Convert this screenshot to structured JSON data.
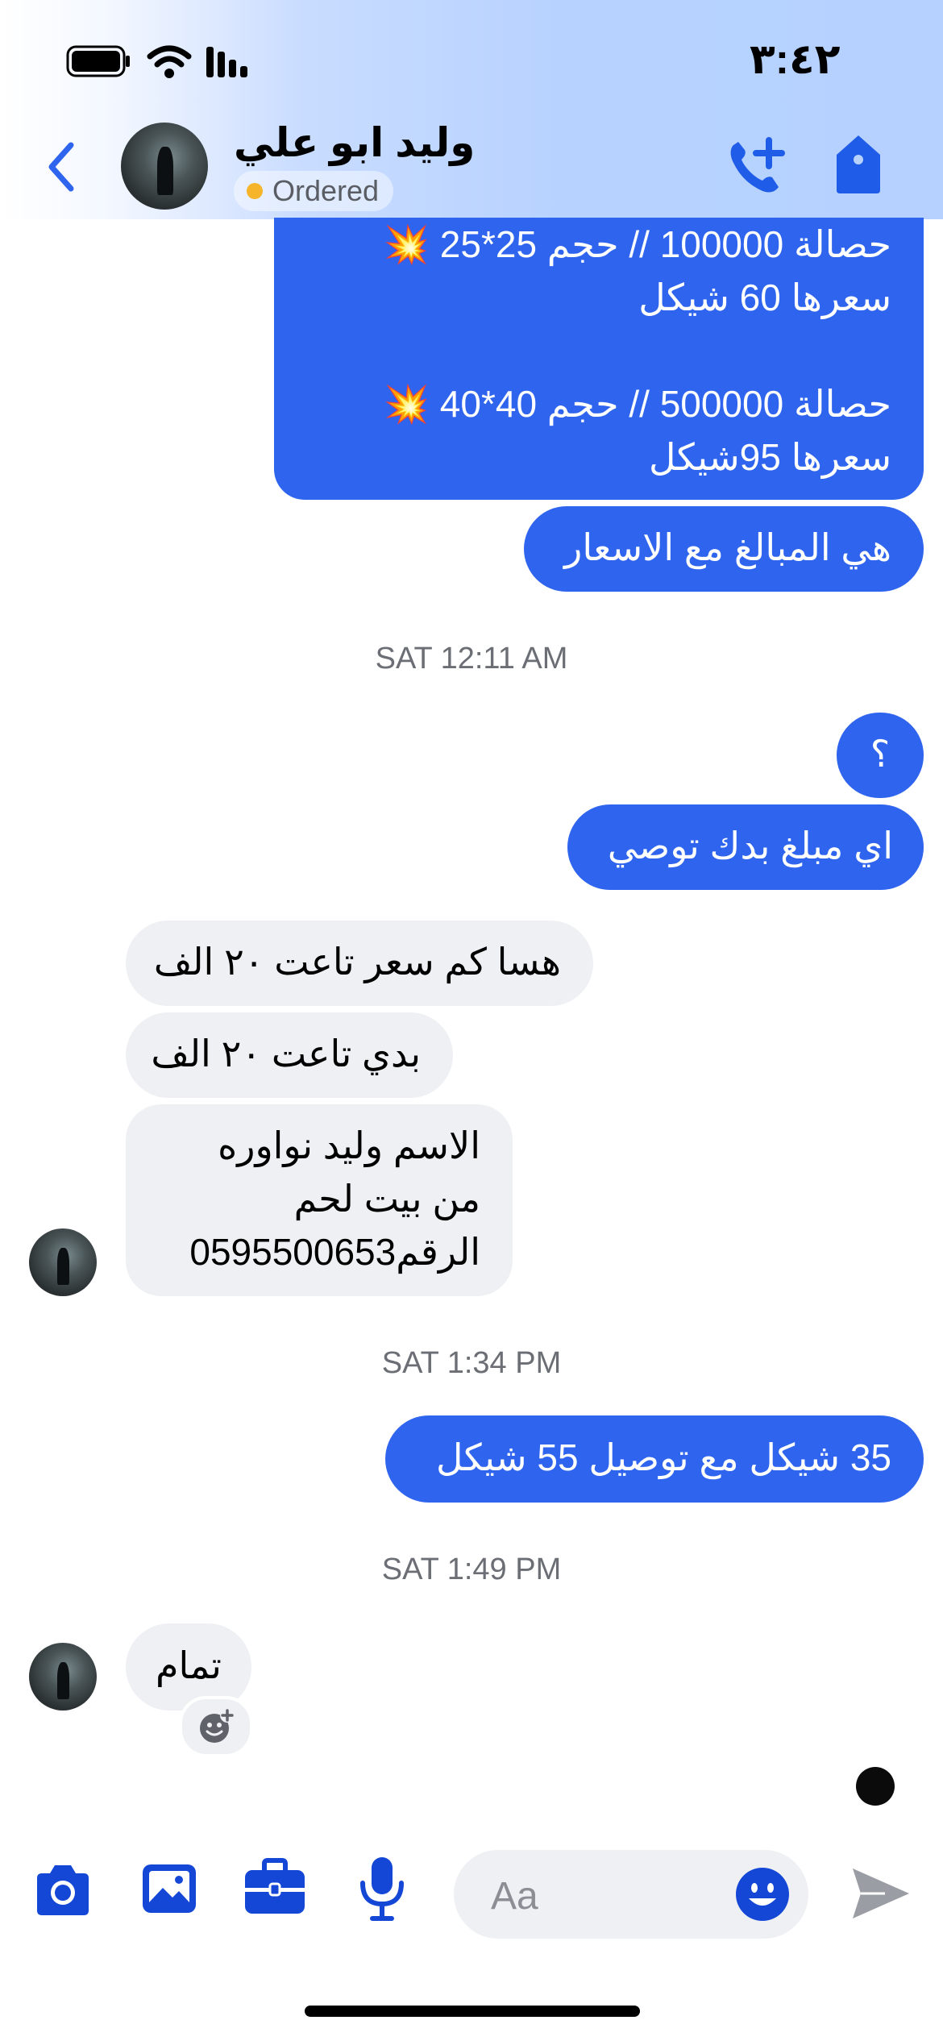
{
  "status_bar": {
    "time": "٣:٤٢"
  },
  "header": {
    "contact_name": "وليد ابو علي",
    "status_label": "Ordered",
    "status_dot_color": "#f6b42b",
    "icons": [
      "back-chevron-icon",
      "phone-plus-icon",
      "tag-icon"
    ]
  },
  "messages": {
    "out_prices": "حصالة 100000 //  حجم 25*25 💥\nسعرها 60 شيكل\n\nحصالة 500000 // حجم 40*40 💥\nسعرها 95شيكل",
    "out_amounts": "هي المبالغ مع الاسعار",
    "ts1": "SAT 12:11 AM",
    "out_q": "؟",
    "out_which": "اي مبلغ بدك توصي",
    "in_how_much": "هسا كم سعر تاعت ٢٠ الف",
    "in_want": "بدي تاعت ٢٠ الف",
    "in_details": "الاسم وليد نواوره\nمن بيت لحم\nالرقم0595500653",
    "ts2": "SAT 1:34 PM",
    "out_price_delivery": "35 شيكل مع توصيل 55 شيكل",
    "ts3": "SAT 1:49 PM",
    "in_ok": "تمام"
  },
  "composer": {
    "placeholder": "Aa",
    "icons": [
      "camera-icon",
      "photo-icon",
      "briefcase-icon",
      "microphone-icon",
      "emoji-icon",
      "send-icon"
    ]
  },
  "colors": {
    "accent": "#2f64ef",
    "incoming_bubble": "#eff0f4",
    "icon_blue": "#1447d6"
  }
}
